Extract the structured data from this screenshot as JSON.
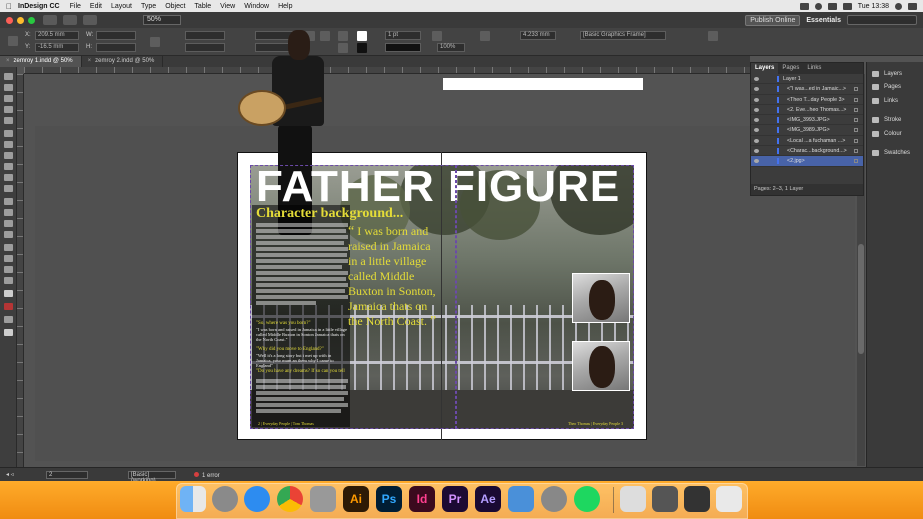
{
  "menubar": {
    "app_name": "InDesign CC",
    "items": [
      "File",
      "Edit",
      "Layout",
      "Type",
      "Object",
      "Table",
      "View",
      "Window",
      "Help"
    ],
    "clock": "Tue 13:38"
  },
  "appbar": {
    "zoom": "50%",
    "publish_label": "Publish Online",
    "workspace": "Essentials"
  },
  "control": {
    "x_label": "X:",
    "x_value": "209.5 mm",
    "y_label": "Y:",
    "y_value": "-16.5 mm",
    "w_label": "W:",
    "h_label": "H:",
    "stroke_weight": "1 pt",
    "opacity": "100%",
    "ref_value": "4.233 mm",
    "frame_style": "[Basic Graphics Frame]"
  },
  "tabs": [
    {
      "label": "zemroy 1.indd @ 50%"
    },
    {
      "label": "zemroy 2.indd @ 50%"
    }
  ],
  "document": {
    "title": "FATHER FIGURE",
    "subhead": "Character background...",
    "q1": "\"So, where was you born?\"",
    "a1": "\"I was born and raised in Jamaica in a little village called Middle Buxton in Sonton Jamaica thats on the North Coast.\"",
    "q2": "\"Why did you move to England?\"",
    "a2": "\"Well it's a long story but i met up with in Jamaica, your mum an them why I came to England\"",
    "q3": "\"Do you have any dreams? If so can you tell",
    "pull_quote": "I was born and raised in Jamaica in a little village called Middle Buxton in Sonton, Jamaica thats on the North Coast.",
    "open_quote": "“",
    "close_quote": "”",
    "footer_left": "2 | Everyday People | Tom Thomas",
    "footer_right": "Theo Thomas | Everyday People 3"
  },
  "layers_panel": {
    "tabs": [
      "Layers",
      "Pages",
      "Links"
    ],
    "layer_name": "Layer 1",
    "rows": [
      "<\"I was...ed in Jamaic...>",
      "<Theo T...day People 3>",
      "<2. Eve...heo Thomas...>",
      "<IMG_3993.JPG>",
      "<IMG_3989.JPG>",
      "<Local ...a fuchaman ...>",
      "<Charac...background...>",
      "<2.jpg>"
    ],
    "footer": "Pages: 2–3, 1 Layer"
  },
  "side_panels": [
    "Layers",
    "Pages",
    "Links",
    "Stroke",
    "Colour",
    "Swatches"
  ],
  "statusbar": {
    "page": "2",
    "workflow": "[Basic] (working)",
    "errors": "1 error"
  },
  "dock": {
    "labels": [
      "Ai",
      "Ps",
      "Id",
      "Pr",
      "Ae"
    ]
  },
  "colors": {
    "accent_yellow": "#e4dc38",
    "selection_blue": "#4863a8",
    "dock_orange": "#f08c12"
  }
}
